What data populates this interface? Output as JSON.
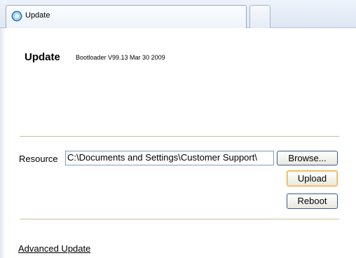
{
  "tabs": [
    {
      "label": "Update",
      "icon": "globe-icon"
    }
  ],
  "page": {
    "title": "Update",
    "bootloader": "Bootloader V99.13 Mar 30 2009"
  },
  "form": {
    "resource_label": "Resource",
    "resource_value": "C:\\Documents and Settings\\Customer Support\\",
    "browse_label": "Browse...",
    "upload_label": "Upload",
    "reboot_label": "Reboot"
  },
  "links": {
    "advanced_update": "Advanced Update"
  },
  "colors": {
    "tab_bar": "#dfe7f3",
    "divider": "#c8c0a0",
    "upload_focus": "#e8a840"
  }
}
